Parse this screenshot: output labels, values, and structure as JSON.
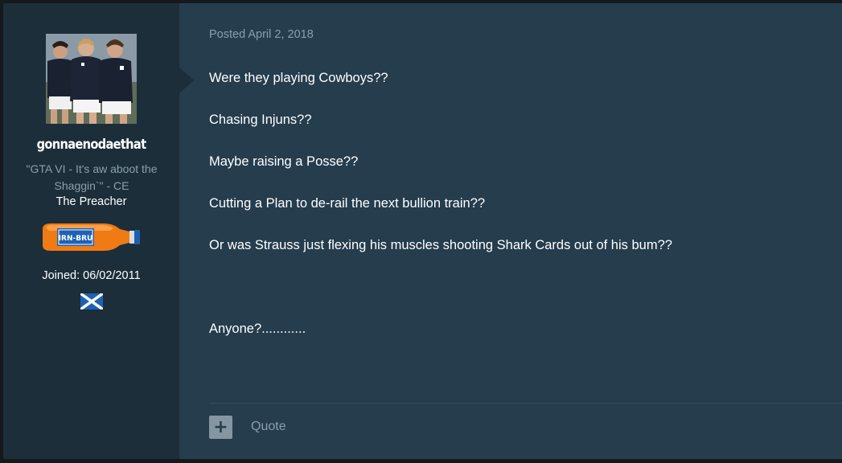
{
  "post": {
    "date_label": "Posted April 2, 2018",
    "paragraphs": [
      "Were they playing Cowboys??",
      "Chasing Injuns??",
      "Maybe raising a Posse??",
      "Cutting a Plan to de-rail the next bullion train??",
      "Or was Strauss just flexing his muscles shooting Shark Cards out of his bum??",
      "Anyone?............"
    ],
    "quote_label": "Quote",
    "multiquote_symbol": "+"
  },
  "author": {
    "username": "gonnaenodaethat",
    "member_title": "\"GTA VI - It's aw aboot the Shaggin`\" - CE",
    "rank": "The Preacher",
    "rank_badge_text": "IRN-BRU",
    "joined": "Joined: 06/02/2011",
    "flag_icon": "scotland-flag-icon"
  },
  "colors": {
    "post_bg": "#253d4d",
    "author_panel_bg": "#1c2e3a",
    "muted_text": "#8a9fae",
    "badge_orange": "#f07a14",
    "flag_blue": "#1f62b5"
  }
}
